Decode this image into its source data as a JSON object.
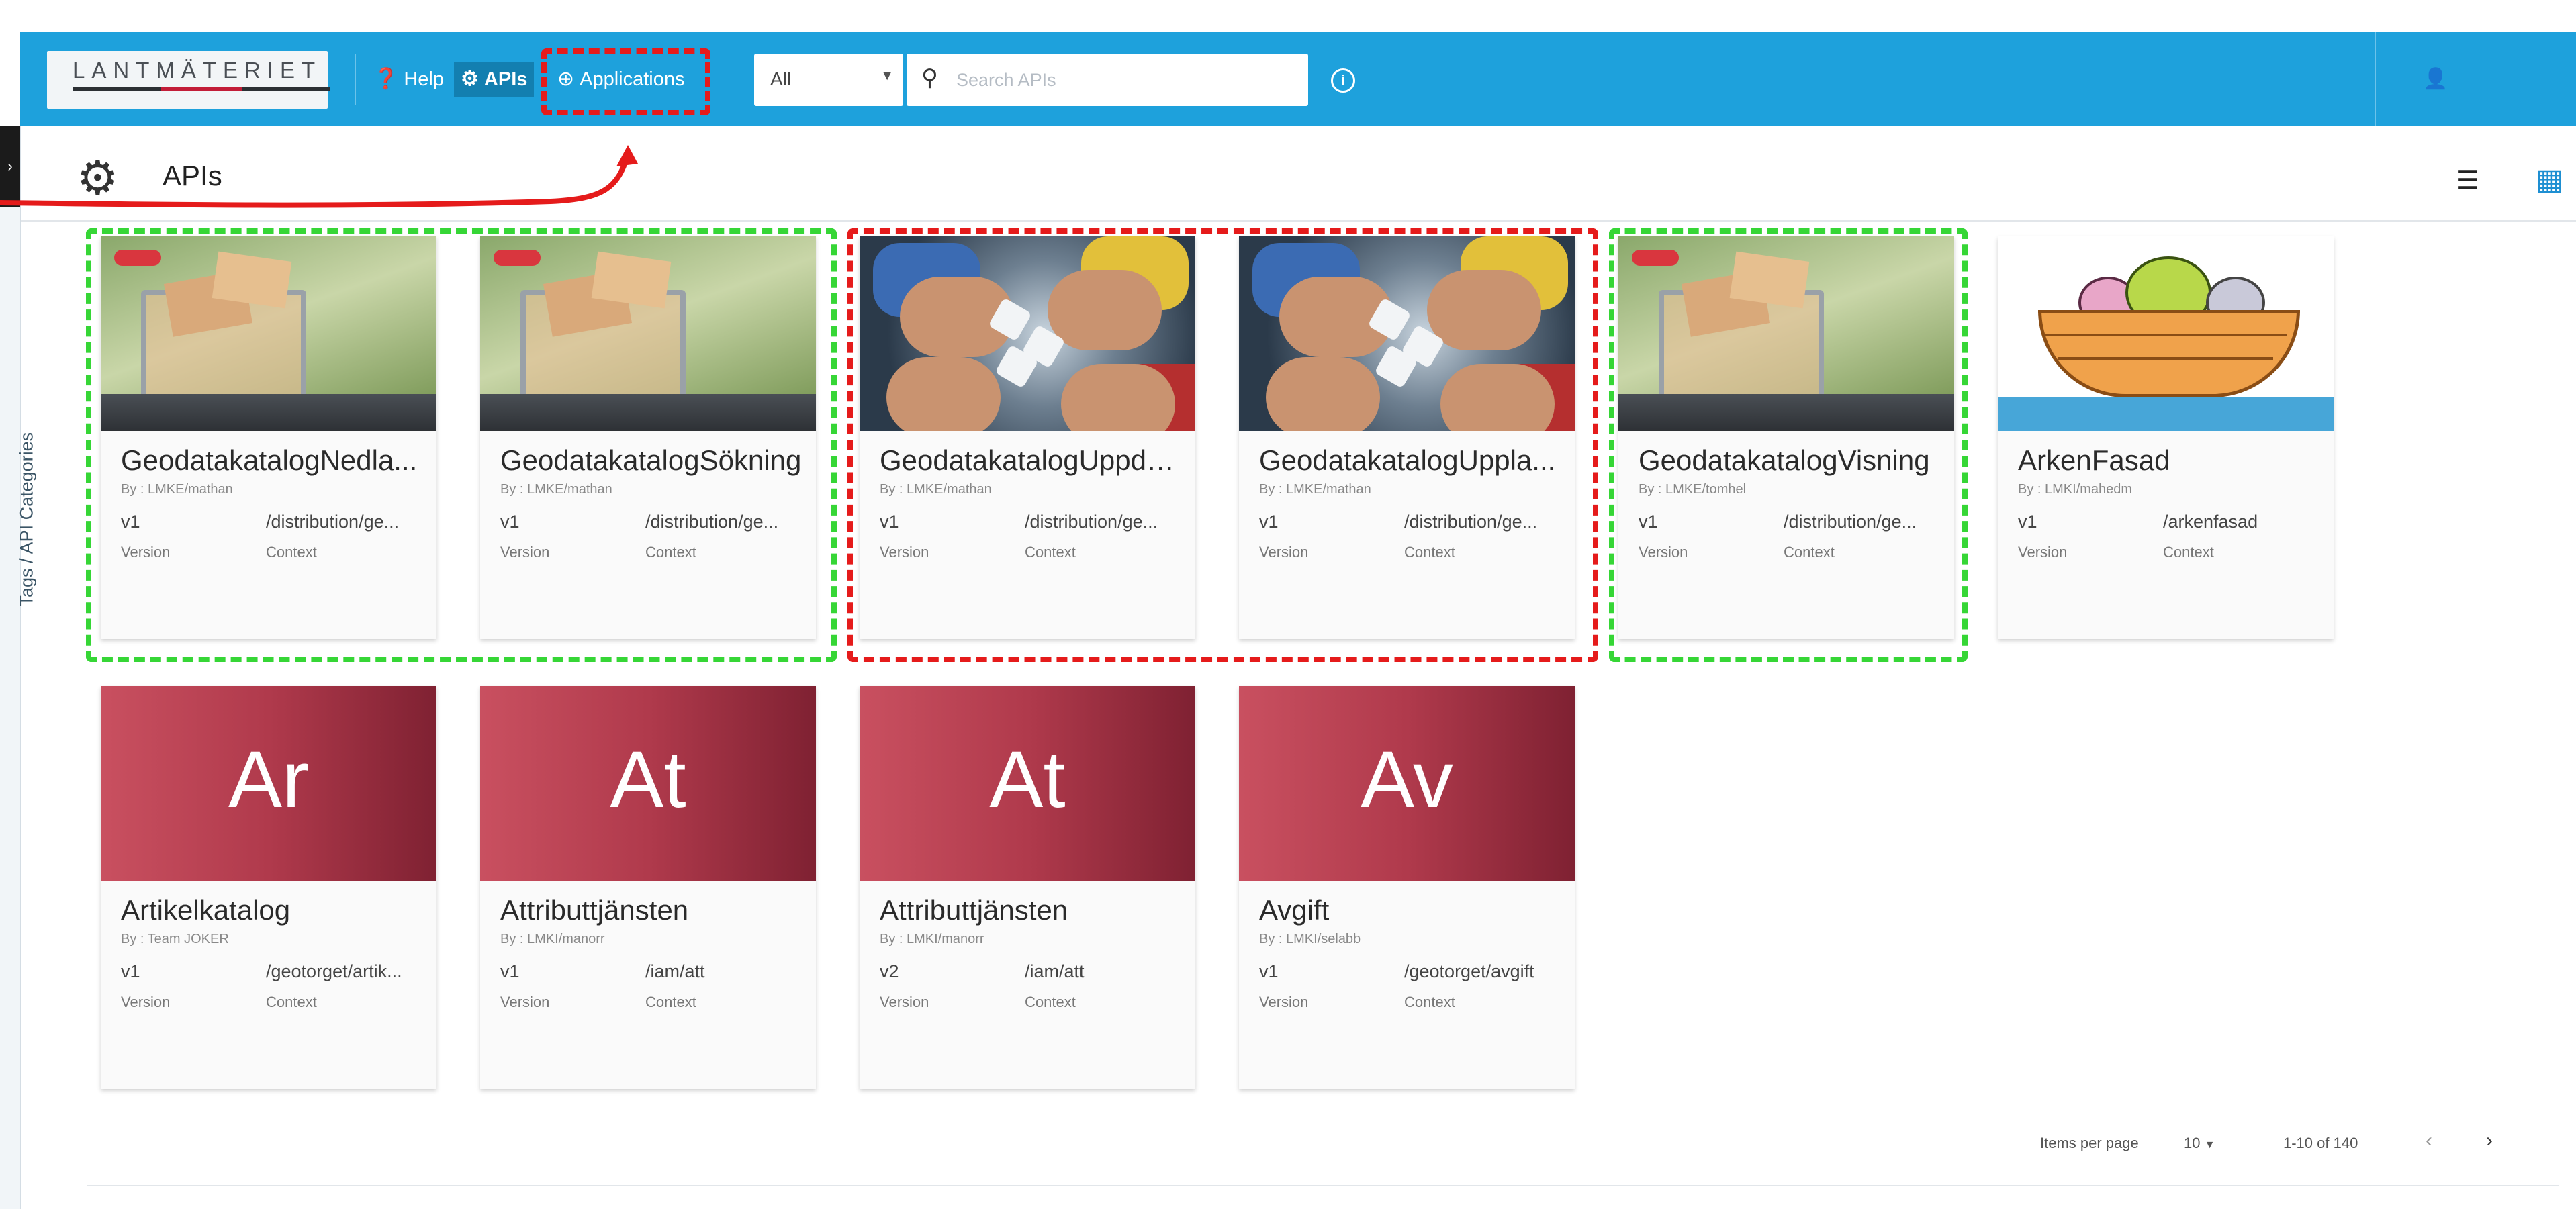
{
  "header": {
    "logo_text": "LANTMÄTERIET",
    "nav": {
      "help": "Help",
      "apis": "APIs",
      "applications": "Applications"
    },
    "filter_value": "All",
    "search_placeholder": "Search APIs"
  },
  "sidebar": {
    "label": "Tags / API Categories"
  },
  "page": {
    "title": "APIs"
  },
  "cards": [
    {
      "name": "GeodatakatalogNedla...",
      "by": "By : LMKE/mathan",
      "version": "v1",
      "context": "/distribution/ge...",
      "version_label": "Version",
      "context_label": "Context",
      "thumbnail": "shopping-cart-image"
    },
    {
      "name": "GeodatakatalogSökning",
      "by": "By : LMKE/mathan",
      "version": "v1",
      "context": "/distribution/ge...",
      "version_label": "Version",
      "context_label": "Context",
      "thumbnail": "shopping-cart-image"
    },
    {
      "name": "GeodatakatalogUppda...",
      "by": "By : LMKE/mathan",
      "version": "v1",
      "context": "/distribution/ge...",
      "version_label": "Version",
      "context_label": "Context",
      "thumbnail": "puzzle-hands-image"
    },
    {
      "name": "GeodatakatalogUppla...",
      "by": "By : LMKE/mathan",
      "version": "v1",
      "context": "/distribution/ge...",
      "version_label": "Version",
      "context_label": "Context",
      "thumbnail": "puzzle-hands-image"
    },
    {
      "name": "GeodatakatalogVisning",
      "by": "By : LMKE/tomhel",
      "version": "v1",
      "context": "/distribution/ge...",
      "version_label": "Version",
      "context_label": "Context",
      "thumbnail": "shopping-cart-image"
    },
    {
      "name": "ArkenFasad",
      "by": "By : LMKI/mahedm",
      "version": "v1",
      "context": "/arkenfasad",
      "version_label": "Version",
      "context_label": "Context",
      "thumbnail": "noahs-ark-image"
    },
    {
      "name": "Artikelkatalog",
      "by": "By : Team JOKER",
      "version": "v1",
      "context": "/geotorget/artik...",
      "version_label": "Version",
      "context_label": "Context",
      "letters": "Ar"
    },
    {
      "name": "Attributtjänsten",
      "by": "By : LMKI/manorr",
      "version": "v1",
      "context": "/iam/att",
      "version_label": "Version",
      "context_label": "Context",
      "letters": "At"
    },
    {
      "name": "Attributtjänsten",
      "by": "By : LMKI/manorr",
      "version": "v2",
      "context": "/iam/att",
      "version_label": "Version",
      "context_label": "Context",
      "letters": "At"
    },
    {
      "name": "Avgift",
      "by": "By : LMKI/selabb",
      "version": "v1",
      "context": "/geotorget/avgift",
      "version_label": "Version",
      "context_label": "Context",
      "letters": "Av"
    }
  ],
  "pagination": {
    "items_per_page_label": "Items per page",
    "items_per_page": "10",
    "range": "1-10 of 140"
  },
  "icons": {
    "help": "help-circle-icon",
    "apis": "gear-icon",
    "applications": "applications-icon",
    "search": "search-icon",
    "info": "info-icon",
    "user": "user-icon",
    "list_view": "list-view-icon",
    "grid_view": "grid-view-icon"
  },
  "colors": {
    "appbar": "#1ea1dc",
    "card_letter_bg": "#b03a4c",
    "highlight_green": "#36d636",
    "highlight_red": "#e51b1b"
  }
}
